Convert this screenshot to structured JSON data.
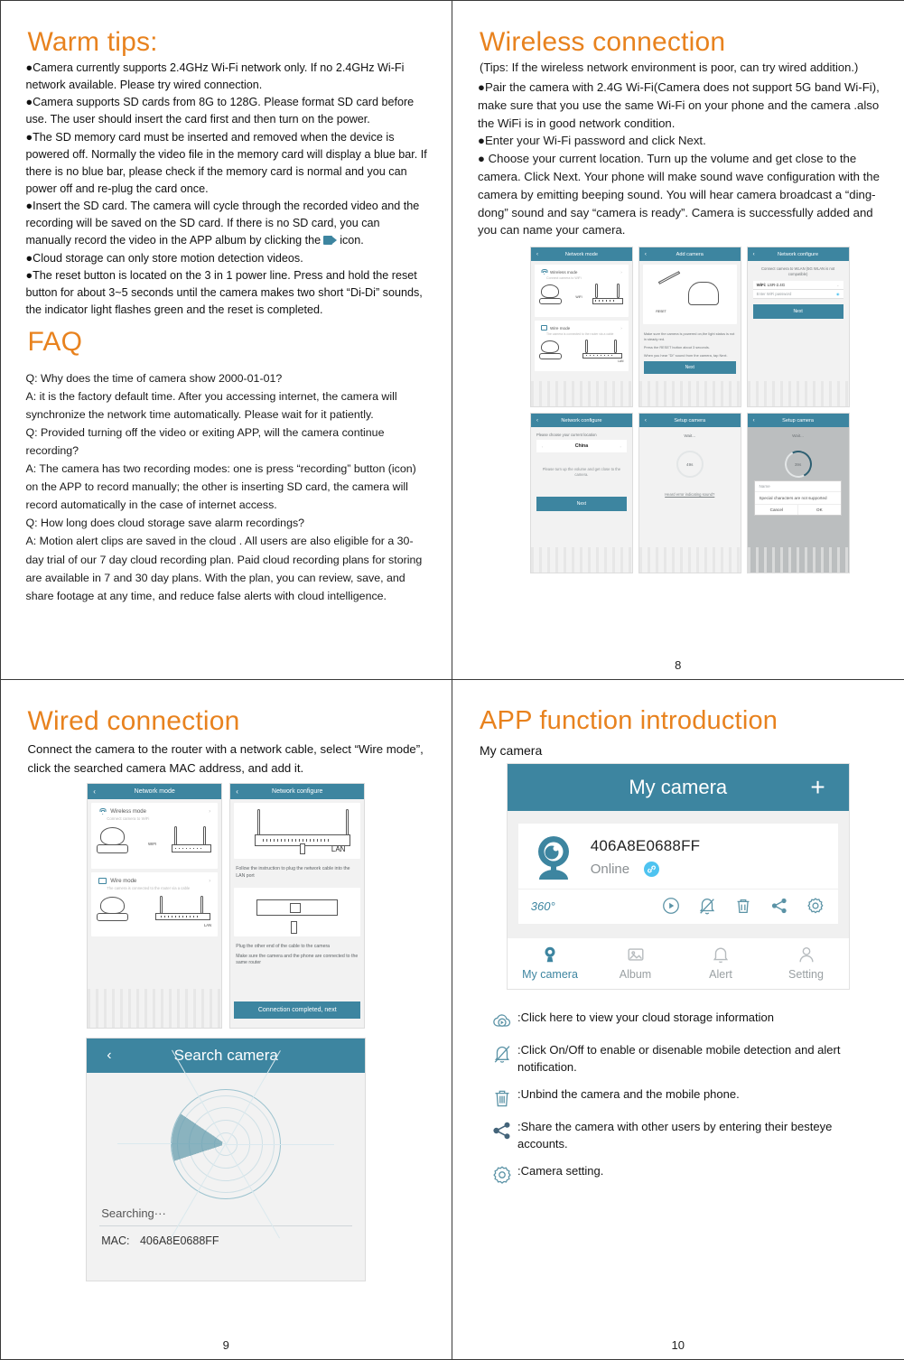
{
  "colors": {
    "heading": "#E8821E",
    "teal": "#3d85a0",
    "link_badge": "#4ec3f0"
  },
  "page_left_top": {
    "heading": "Warm tips:",
    "bullets": [
      "●Camera currently supports 2.4GHz Wi-Fi network only. If no 2.4GHz Wi-Fi network available. Please try wired connection.",
      "●Camera supports SD cards from 8G to 128G. Please format SD card before use. The user should insert the card first and then turn on the power.",
      "●The SD memory card must be inserted and removed when the device is powered off. Normally the video file in the memory card will display a blue bar. If there is no blue bar, please check if the memory card is normal and you can power off and re-plug the card once."
    ],
    "bullet_with_icon_before": "●Insert the SD card. The camera will cycle through the recorded video and the recording will be saved on the SD card. If there is no SD card, you can manually record the video in the APP album by clicking the",
    "bullet_with_icon_after": "icon.",
    "bullets_tail": [
      "●Cloud storage can only store motion detection videos.",
      "●The reset button is located on the 3 in 1 power line. Press and hold the reset button for about 3~5 seconds until the camera makes two short “Di-Di” sounds, the indicator light flashes green and the reset is completed."
    ],
    "faq_heading": "FAQ",
    "faq": [
      "Q: Why does the time of camera show 2000-01-01?",
      "A: it is the factory default time. After you accessing internet, the camera will synchronize the network time automatically. Please wait for it patiently.",
      "Q: Provided turning off the video or exiting APP, will the camera continue recording?",
      "A: The camera has two recording modes: one is press “recording” button (icon) on the APP to record manually; the other is inserting SD card, the camera will record automatically in the case of internet access.",
      "Q: How long does cloud storage save alarm recordings?",
      "A: Motion alert clips are saved in the cloud . All users are also eligible for a 30-day trial of our 7 day cloud recording plan. Paid cloud recording plans for storing are available in 7 and 30 day plans. With the plan, you can review, save, and share footage at any time, and reduce false alerts with cloud intelligence."
    ]
  },
  "page_right_top": {
    "heading": "Wireless connection",
    "tips": "(Tips: If the wireless network environment is poor, can try wired addition.)",
    "bullets": [
      "●Pair the camera with 2.4G Wi-Fi(Camera does not support 5G band Wi-Fi), make sure that you use the same Wi-Fi on your phone and the camera .also the WiFi  is in good network condition.",
      "●Enter your Wi-Fi password and click Next.",
      "● Choose your current location. Turn up the volume and get close to the camera. Click Next. Your phone will make sound wave configuration with the camera by emitting beeping sound. You will hear camera broadcast a “ding-dong” sound and say “camera is ready”. Camera is successfully added and you can name your camera."
    ],
    "page_number": "8",
    "screens": [
      {
        "title": "Network mode",
        "rows": [
          {
            "label": "Wireless mode",
            "sub": "Connect camera to WiFi",
            "wifi_tag": "WIFI"
          },
          {
            "label": "Wire mode",
            "sub": "The camera is connected to the router via a cable",
            "lan_tag": "LAN"
          }
        ]
      },
      {
        "title": "Add camera",
        "reset_label": "RESET",
        "lines": [
          "Make sure the camera is powered on,the light status is not in steady red.",
          "Press the RESET button about 3 seconds.",
          "When you hear \"Di\" sound from the camera, tap Next.",
          ""
        ],
        "button": "Next"
      },
      {
        "title": "Network configure",
        "note": "Connect camera to WLAN (5G WLAN is not compatible)",
        "wifi_label": "WiFi:",
        "wifi_value": "LSR-2.4G",
        "password_placeholder": "Enter WiFi password",
        "button": "Next"
      },
      {
        "title": "Network configure",
        "note": "Please choose your current location",
        "location": "China",
        "hint": "Please turn up the volume and get close to the camera.",
        "button": "Next"
      },
      {
        "title": "Setup camera",
        "wait": "Wait...",
        "countdown": "49s",
        "link": "Heard error indicating sound?"
      },
      {
        "title": "Setup camera",
        "wait": "Wait...",
        "countdown": "39s",
        "dialog": {
          "name_placeholder": "Name",
          "message": "Special characters are not supported",
          "cancel": "Cancel",
          "ok": "OK"
        }
      }
    ]
  },
  "page_left_bottom": {
    "heading": "Wired connection",
    "intro": "Connect the camera to the router with a network cable, select “Wire mode”, click the searched camera MAC address, and add it.",
    "page_number": "9",
    "screen_network_mode": {
      "title": "Network mode",
      "wireless_label": "Wireless mode",
      "wireless_sub": "Connect camera to WiFi",
      "wifi_tag": "WIFI",
      "wire_label": "Wire mode",
      "wire_sub": "The camera is connected to the router via a cable",
      "lan_tag": "LAN"
    },
    "screen_network_configure": {
      "title": "Network configure",
      "lan_tag": "LAN",
      "step1": "Follow the instruction to plug the network cable into the LAN port",
      "step2": "Plug the other end of the cable to the camera",
      "step3": "Make sure the camera and the phone are connected to the same router",
      "button": "Connection completed, next"
    },
    "screen_search": {
      "title": "Search camera",
      "searching": "Searching···",
      "mac_label": "MAC:",
      "mac_value": "406A8E0688FF"
    }
  },
  "page_right_bottom": {
    "heading": "APP function introduction",
    "subtitle": "My camera",
    "page_number": "10",
    "app": {
      "title": "My camera",
      "add": "+",
      "device_id": "406A8E0688FF",
      "status": "Online",
      "pan_label": "360°",
      "nav": [
        {
          "label": "My camera",
          "icon": "camera-icon",
          "active": true
        },
        {
          "label": "Album",
          "icon": "image-icon",
          "active": false
        },
        {
          "label": "Alert",
          "icon": "bell-icon",
          "active": false
        },
        {
          "label": "Setting",
          "icon": "user-icon",
          "active": false
        }
      ]
    },
    "legend": [
      {
        "icon": "cloud-play-icon",
        "text": ":Click here to view your cloud storage information"
      },
      {
        "icon": "bell-off-icon",
        "text": ":Click On/Off to enable or disenable mobile detection and alert notification."
      },
      {
        "icon": "trash-icon",
        "text": ":Unbind the camera and the mobile phone."
      },
      {
        "icon": "share-icon",
        "text": ":Share the camera with other users by entering their besteye accounts."
      },
      {
        "icon": "gear-icon",
        "text": ":Camera setting."
      }
    ]
  }
}
